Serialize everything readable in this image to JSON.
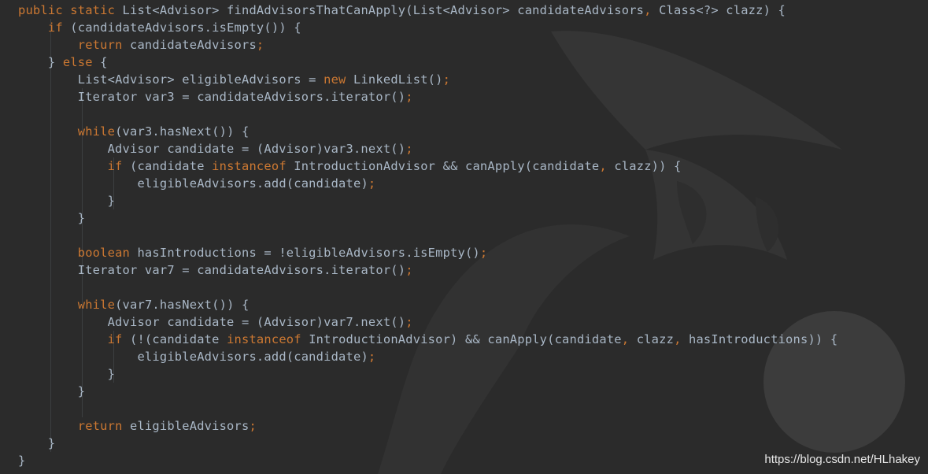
{
  "editor": {
    "lines": [
      {
        "indent": "",
        "tokens": [
          [
            "k",
            "public static "
          ],
          [
            "i",
            "List<Advisor> findAdvisorsThatCanApply(List<Advisor> candidateAdvisors"
          ],
          [
            "p",
            ", "
          ],
          [
            "i",
            "Class<?> clazz) {"
          ]
        ]
      },
      {
        "indent": "    ",
        "tokens": [
          [
            "k",
            "if "
          ],
          [
            "i",
            "(candidateAdvisors.isEmpty()) {"
          ]
        ]
      },
      {
        "indent": "        ",
        "tokens": [
          [
            "k",
            "return "
          ],
          [
            "i",
            "candidateAdvisors"
          ],
          [
            "p",
            ";"
          ]
        ]
      },
      {
        "indent": "    ",
        "tokens": [
          [
            "i",
            "} "
          ],
          [
            "k",
            "else "
          ],
          [
            "i",
            "{"
          ]
        ]
      },
      {
        "indent": "        ",
        "tokens": [
          [
            "i",
            "List<Advisor> eligibleAdvisors = "
          ],
          [
            "k",
            "new "
          ],
          [
            "i",
            "LinkedList()"
          ],
          [
            "p",
            ";"
          ]
        ]
      },
      {
        "indent": "        ",
        "tokens": [
          [
            "i",
            "Iterator var3 = candidateAdvisors.iterator()"
          ],
          [
            "p",
            ";"
          ]
        ]
      },
      {
        "indent": "",
        "tokens": []
      },
      {
        "indent": "        ",
        "tokens": [
          [
            "k",
            "while"
          ],
          [
            "i",
            "(var3.hasNext()) {"
          ]
        ]
      },
      {
        "indent": "            ",
        "tokens": [
          [
            "i",
            "Advisor candidate = (Advisor)var3.next()"
          ],
          [
            "p",
            ";"
          ]
        ]
      },
      {
        "indent": "            ",
        "tokens": [
          [
            "k",
            "if "
          ],
          [
            "i",
            "(candidate "
          ],
          [
            "k",
            "instanceof "
          ],
          [
            "i",
            "IntroductionAdvisor && canApply(candidate"
          ],
          [
            "p",
            ", "
          ],
          [
            "i",
            "clazz)) {"
          ]
        ]
      },
      {
        "indent": "                ",
        "tokens": [
          [
            "i",
            "eligibleAdvisors.add(candidate)"
          ],
          [
            "p",
            ";"
          ]
        ]
      },
      {
        "indent": "            ",
        "tokens": [
          [
            "i",
            "}"
          ]
        ]
      },
      {
        "indent": "        ",
        "tokens": [
          [
            "i",
            "}"
          ]
        ]
      },
      {
        "indent": "",
        "tokens": []
      },
      {
        "indent": "        ",
        "tokens": [
          [
            "k",
            "boolean "
          ],
          [
            "i",
            "hasIntroductions = !eligibleAdvisors.isEmpty()"
          ],
          [
            "p",
            ";"
          ]
        ]
      },
      {
        "indent": "        ",
        "tokens": [
          [
            "i",
            "Iterator var7 = candidateAdvisors.iterator()"
          ],
          [
            "p",
            ";"
          ]
        ]
      },
      {
        "indent": "",
        "tokens": []
      },
      {
        "indent": "        ",
        "tokens": [
          [
            "k",
            "while"
          ],
          [
            "i",
            "(var7.hasNext()) {"
          ]
        ]
      },
      {
        "indent": "            ",
        "tokens": [
          [
            "i",
            "Advisor candidate = (Advisor)var7.next()"
          ],
          [
            "p",
            ";"
          ]
        ]
      },
      {
        "indent": "            ",
        "tokens": [
          [
            "k",
            "if "
          ],
          [
            "i",
            "(!(candidate "
          ],
          [
            "k",
            "instanceof "
          ],
          [
            "i",
            "IntroductionAdvisor) && canApply(candidate"
          ],
          [
            "p",
            ", "
          ],
          [
            "i",
            "clazz"
          ],
          [
            "p",
            ", "
          ],
          [
            "i",
            "hasIntroductions)) {"
          ]
        ]
      },
      {
        "indent": "                ",
        "tokens": [
          [
            "i",
            "eligibleAdvisors.add(candidate)"
          ],
          [
            "p",
            ";"
          ]
        ]
      },
      {
        "indent": "            ",
        "tokens": [
          [
            "i",
            "}"
          ]
        ]
      },
      {
        "indent": "        ",
        "tokens": [
          [
            "i",
            "}"
          ]
        ]
      },
      {
        "indent": "",
        "tokens": []
      },
      {
        "indent": "        ",
        "tokens": [
          [
            "k",
            "return "
          ],
          [
            "i",
            "eligibleAdvisors"
          ],
          [
            "p",
            ";"
          ]
        ]
      },
      {
        "indent": "    ",
        "tokens": [
          [
            "i",
            "}"
          ]
        ]
      },
      {
        "indent": "",
        "tokens": [
          [
            "i",
            "}"
          ]
        ]
      }
    ]
  },
  "watermark": "https://blog.csdn.net/HLhakey",
  "colors": {
    "background": "#2b2b2b",
    "keyword": "#cc7832",
    "identifier": "#a9b7c6",
    "logo": "#3a3a3a"
  },
  "icons": {
    "background_logo": "ide-logo-watermark"
  }
}
